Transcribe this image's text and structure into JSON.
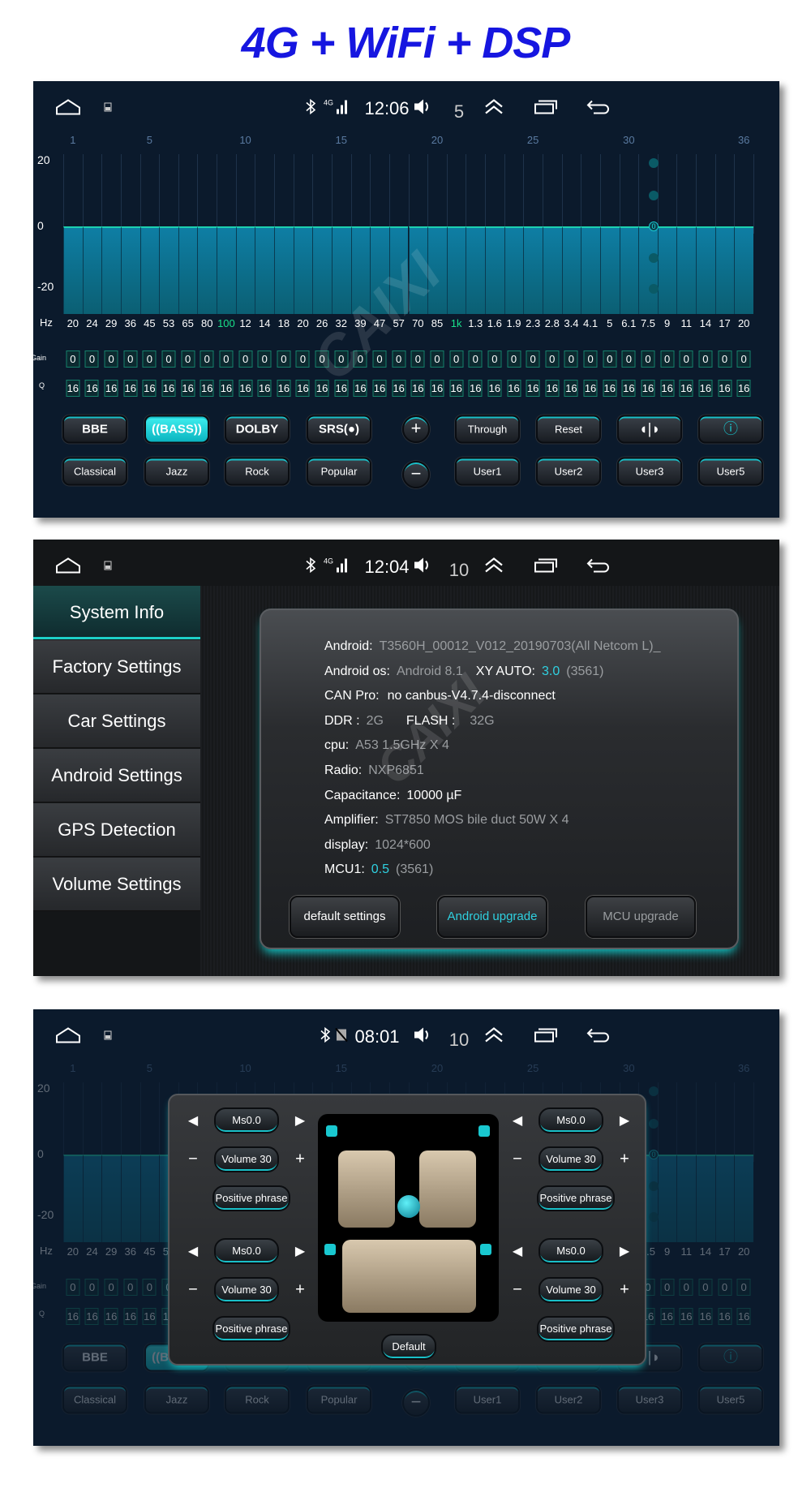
{
  "title": "4G + WiFi + DSP",
  "watermark": "CAIXI",
  "eq": {
    "status": {
      "time": "12:06",
      "volume": "5",
      "network": "4G"
    },
    "column_numbers": [
      "1",
      "5",
      "10",
      "15",
      "20",
      "25",
      "30",
      "36"
    ],
    "y_labels": [
      "20",
      "0",
      "-20"
    ],
    "right_value": "0",
    "hz_label": "Hz",
    "gain_label": "Gain",
    "q_label": "Q",
    "frequencies": [
      "20",
      "24",
      "29",
      "36",
      "45",
      "53",
      "65",
      "80",
      "100",
      "12",
      "14",
      "18",
      "20",
      "26",
      "32",
      "39",
      "47",
      "57",
      "70",
      "85",
      "1k",
      "1.3",
      "1.6",
      "1.9",
      "2.3",
      "2.8",
      "3.4",
      "4.1",
      "5",
      "6.1",
      "7.5",
      "9",
      "11",
      "14",
      "17",
      "20"
    ],
    "highlighted_frequencies": [
      "100",
      "1k"
    ],
    "gains": [
      0,
      0,
      0,
      0,
      0,
      0,
      0,
      0,
      0,
      0,
      0,
      0,
      0,
      0,
      0,
      0,
      0,
      0,
      0,
      0,
      0,
      0,
      0,
      0,
      0,
      0,
      0,
      0,
      0,
      0,
      0,
      0,
      0,
      0,
      0,
      0
    ],
    "q_values": [
      16,
      16,
      16,
      16,
      16,
      16,
      16,
      16,
      16,
      16,
      16,
      16,
      16,
      16,
      16,
      16,
      16,
      16,
      16,
      16,
      16,
      16,
      16,
      16,
      16,
      16,
      16,
      16,
      16,
      16,
      16,
      16,
      16,
      16,
      16,
      16
    ],
    "effects": [
      "BBE",
      "((BASS))",
      "DOLBY",
      "SRS(●)"
    ],
    "active_effect": "((BASS))",
    "plus": "+",
    "minus": "−",
    "actions": [
      "Through",
      "Reset",
      "◖|◗",
      "ⓘ"
    ],
    "presets": [
      "Classical",
      "Jazz",
      "Rock",
      "Popular"
    ],
    "user_presets": [
      "User1",
      "User2",
      "User3",
      "User5"
    ],
    "accent": "#1dd0c8"
  },
  "settings": {
    "status": {
      "time": "12:04",
      "volume": "10",
      "network": "4G"
    },
    "sidebar": [
      "System Info",
      "Factory Settings",
      "Car Settings",
      "Android Settings",
      "GPS Detection",
      "Volume Settings"
    ],
    "active": "System Info",
    "info": {
      "android": {
        "label": "Android:",
        "value": "T3560H_00012_V012_20190703(All Netcom L)_"
      },
      "android_os": {
        "label": "Android os:",
        "value": "Android 8.1",
        "xy_label": "XY AUTO:",
        "xy_value": "3.0",
        "xy_code": "(3561)"
      },
      "can_pro": {
        "label": "CAN Pro:",
        "value": "no canbus-V4.7.4-disconnect"
      },
      "ddr": {
        "label": "DDR :",
        "value": "2G",
        "flash_label": "FLASH :",
        "flash_value": "32G"
      },
      "cpu": {
        "label": "cpu:",
        "value": "A53 1.5GHz X 4"
      },
      "radio": {
        "label": "Radio:",
        "value": "NXP6851"
      },
      "capacitance": {
        "label": "Capacitance:",
        "value": "10000 µF"
      },
      "amplifier": {
        "label": "Amplifier:",
        "value": "ST7850 MOS bile duct 50W X 4"
      },
      "display": {
        "label": "display:",
        "value": "1024*600"
      },
      "mcu": {
        "label": "MCU1:",
        "value": "0.5",
        "code": "(3561)"
      }
    },
    "buttons": [
      "default settings",
      "Android upgrade",
      "MCU upgrade"
    ]
  },
  "balance": {
    "status": {
      "time": "08:01",
      "volume": "10"
    },
    "channels": [
      {
        "delay": "Ms0.0",
        "volume": "Volume 30",
        "phase": "Positive phrase"
      },
      {
        "delay": "Ms0.0",
        "volume": "Volume 30",
        "phase": "Positive phrase"
      },
      {
        "delay": "Ms0.0",
        "volume": "Volume 30",
        "phase": "Positive phrase"
      },
      {
        "delay": "Ms0.0",
        "volume": "Volume 30",
        "phase": "Positive phrase"
      }
    ],
    "default_label": "Default"
  }
}
